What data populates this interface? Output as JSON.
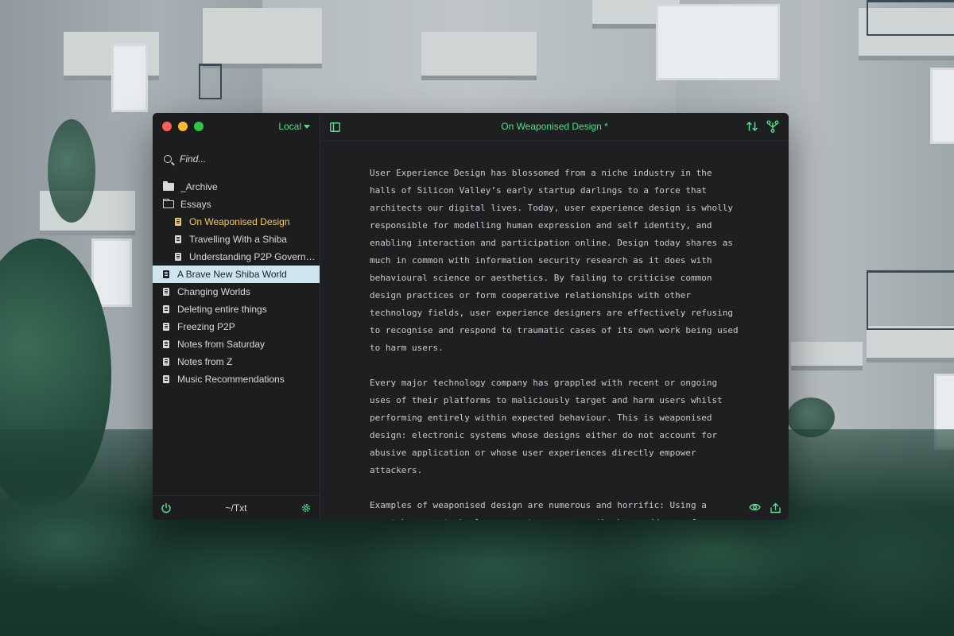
{
  "window": {
    "title": "On Weaponised Design *",
    "source_label": "Local",
    "search_placeholder": "Find...",
    "footer_path": "~/Txt"
  },
  "sidebar": {
    "items": [
      {
        "label": "_Archive",
        "type": "folder-closed",
        "level": 0
      },
      {
        "label": "Essays",
        "type": "folder-open",
        "level": 0
      },
      {
        "label": "On Weaponised Design",
        "type": "doc",
        "level": 1,
        "state": "active"
      },
      {
        "label": "Travelling With a Shiba",
        "type": "doc",
        "level": 1
      },
      {
        "label": "Understanding P2P Governa...",
        "type": "doc",
        "level": 1
      },
      {
        "label": "A Brave New Shiba World",
        "type": "doc",
        "level": 0,
        "state": "selected"
      },
      {
        "label": "Changing Worlds",
        "type": "doc",
        "level": 0
      },
      {
        "label": "Deleting entire things",
        "type": "doc",
        "level": 0
      },
      {
        "label": "Freezing P2P",
        "type": "doc",
        "level": 0
      },
      {
        "label": "Notes from Saturday",
        "type": "doc",
        "level": 0
      },
      {
        "label": "Notes from Z",
        "type": "doc",
        "level": 0
      },
      {
        "label": "Music Recommendations",
        "type": "doc",
        "level": 0
      }
    ]
  },
  "editor": {
    "paragraphs": [
      "User Experience Design has blossomed from a niche industry in the halls of Silicon Valley’s early startup darlings to a force that architects our digital lives. Today, user experience design is wholly responsible for modelling human expression and self identity, and enabling interaction and participation online. Design today shares as much in common with information security research as it does with behavioural science or aesthetics. By failing to criticise common design practices or form cooperative relationships with other technology fields, user experience designers are effectively refusing to recognise and respond to traumatic cases of its own work being used to harm users.",
      "Every major technology company has grappled with recent or ongoing uses of their platforms to maliciously target and harm users whilst performing entirely within expected behaviour. This is weaponised design: electronic systems whose designs either do not account for abusive application or whose user experiences directly empower attackers.",
      "Examples of weaponised design are numerous and horrific: Using a smartphone, a technology reporter uncovers the home address of a friend"
    ]
  },
  "colors": {
    "accent": "#4fe08a",
    "active_doc": "#f7c948",
    "selected_bg": "#cfe6f0",
    "window_bg": "#1e1f21"
  },
  "icons": {
    "toolbar": [
      "sidebar-toggle-icon",
      "sync-icon",
      "branch-icon"
    ],
    "footer_left": "power-icon",
    "footer_right": "gear-icon",
    "editor_footer": [
      "eye-icon",
      "share-icon"
    ]
  }
}
